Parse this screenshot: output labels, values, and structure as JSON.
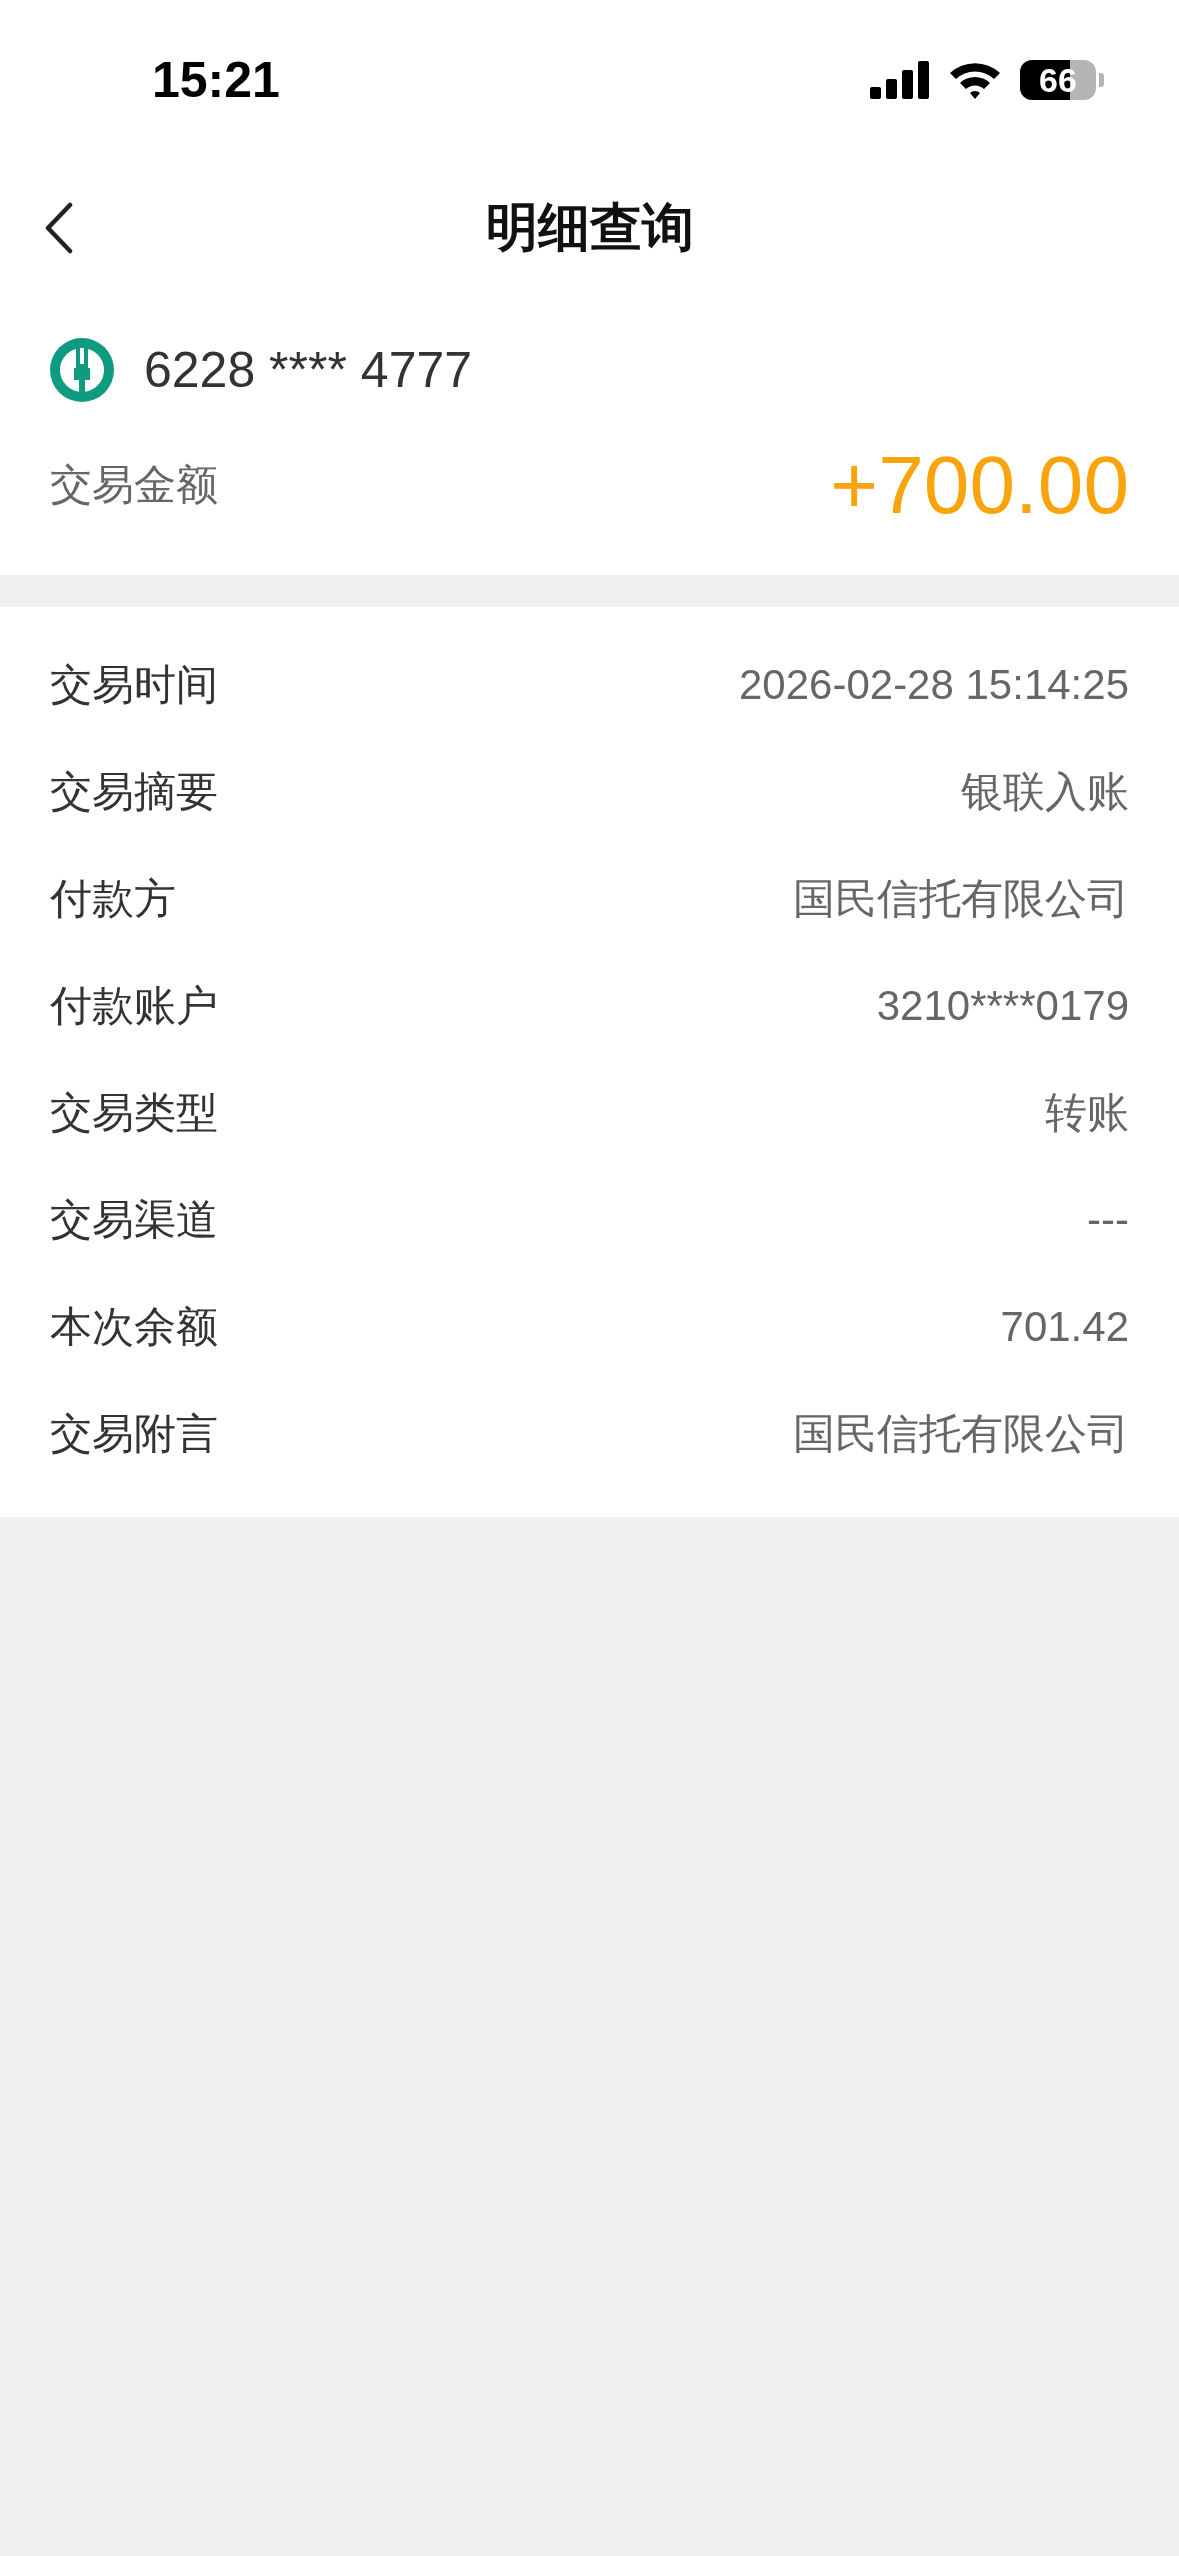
{
  "status_bar": {
    "time": "15:21",
    "battery": "66"
  },
  "header": {
    "title": "明细查询"
  },
  "account": {
    "card_number": "6228 **** 4777",
    "amount_label": "交易金额",
    "amount": "+700.00"
  },
  "details": [
    {
      "label": "交易时间",
      "value": "2026-02-28 15:14:25"
    },
    {
      "label": "交易摘要",
      "value": "银联入账"
    },
    {
      "label": "付款方",
      "value": "国民信托有限公司"
    },
    {
      "label": "付款账户",
      "value": "3210****0179"
    },
    {
      "label": "交易类型",
      "value": "转账"
    },
    {
      "label": "交易渠道",
      "value": "---"
    },
    {
      "label": "本次余额",
      "value": "701.42"
    },
    {
      "label": "交易附言",
      "value": "国民信托有限公司"
    }
  ]
}
